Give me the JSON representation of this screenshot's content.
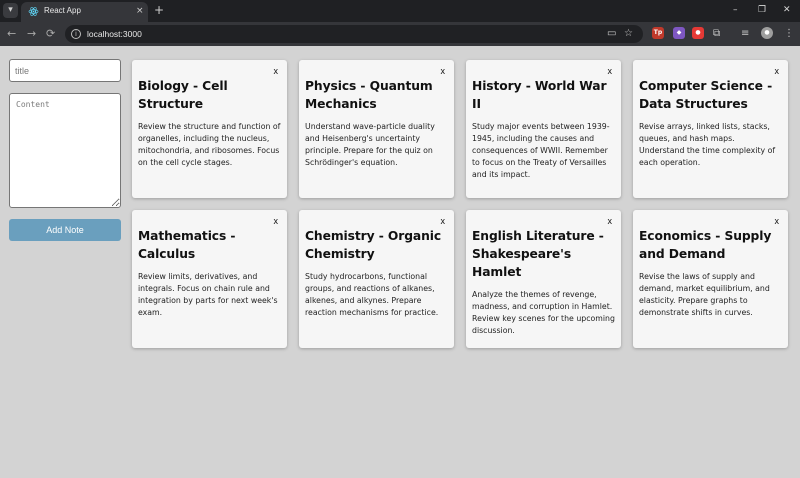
{
  "browser": {
    "tab_title": "React App",
    "url": "localhost:3000",
    "tab_close_glyph": "×",
    "new_tab_glyph": "+",
    "window_controls": [
      "–",
      "❐",
      "✕"
    ],
    "nav": {
      "back": "←",
      "forward": "→",
      "reload": "⟳"
    },
    "menu_glyph": "⋮"
  },
  "form": {
    "title_placeholder": "title",
    "content_placeholder": "Content",
    "add_button_label": "Add Note"
  },
  "notes": [
    {
      "title": "Biology - Cell Structure",
      "content": "Review the structure and function of organelles, including the nucleus, mitochondria, and ribosomes. Focus on the cell cycle stages."
    },
    {
      "title": "Physics - Quantum Mechanics",
      "content": "Understand wave-particle duality and Heisenberg's uncertainty principle. Prepare for the quiz on Schrödinger's equation."
    },
    {
      "title": "History - World War II",
      "content": "Study major events between 1939-1945, including the causes and consequences of WWII. Remember to focus on the Treaty of Versailles and its impact."
    },
    {
      "title": "Computer Science - Data Structures",
      "content": "Revise arrays, linked lists, stacks, queues, and hash maps. Understand the time complexity of each operation."
    },
    {
      "title": "Mathematics - Calculus",
      "content": "Review limits, derivatives, and integrals. Focus on chain rule and integration by parts for next week's exam."
    },
    {
      "title": "Chemistry - Organic Chemistry",
      "content": "Study hydrocarbons, functional groups, and reactions of alkanes, alkenes, and alkynes. Prepare reaction mechanisms for practice."
    },
    {
      "title": "English Literature - Shakespeare's Hamlet",
      "content": "Analyze the themes of revenge, madness, and corruption in Hamlet. Review key scenes for the upcoming discussion."
    },
    {
      "title": "Economics - Supply and Demand",
      "content": "Revise the laws of supply and demand, market equilibrium, and elasticity. Prepare graphs to demonstrate shifts in curves."
    }
  ],
  "delete_label": "x",
  "colors": {
    "page_bg": "#d3d3d3",
    "card_bg": "#f6f6f6",
    "button_bg": "#6a9fbe"
  }
}
